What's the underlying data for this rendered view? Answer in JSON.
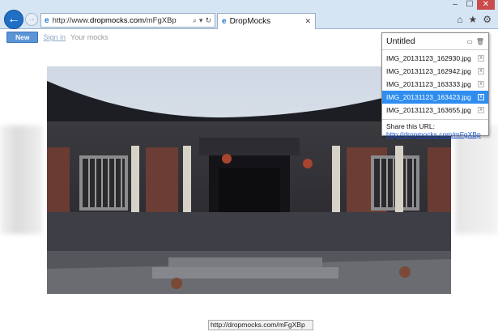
{
  "browser": {
    "window_controls": [
      "–",
      "☐",
      "✕"
    ],
    "address_scheme": "http://www.",
    "address_domain": "dropmocks.com",
    "address_path": "/mFgXBp",
    "address_controls": [
      "⌕",
      "▾",
      "↻"
    ],
    "tab_label": "DropMocks",
    "tab_close": "✕",
    "tools": [
      "⌂",
      "★",
      "⚙"
    ]
  },
  "topbar": {
    "new_label": "New",
    "signin_label": "Sign in",
    "your_mocks_label": "Your mocks"
  },
  "panel": {
    "title": "Untitled",
    "files": [
      {
        "name": "IMG_20131123_162930.jpg",
        "selected": false
      },
      {
        "name": "IMG_20131123_162942.jpg",
        "selected": false
      },
      {
        "name": "IMG_20131123_163333.jpg",
        "selected": false
      },
      {
        "name": "IMG_20131123_163423.jpg",
        "selected": true
      },
      {
        "name": "IMG_20131123_163655.jpg",
        "selected": false
      }
    ],
    "share_label": "Share this URL:",
    "share_url": "http://dropmocks.com/mFgXBp"
  },
  "status": {
    "hover_url": "http://dropmocks.com/mFgXBp"
  },
  "colors": {
    "accent": "#2f8df0",
    "new_button": "#5b95d6",
    "link": "#1a56d6"
  }
}
